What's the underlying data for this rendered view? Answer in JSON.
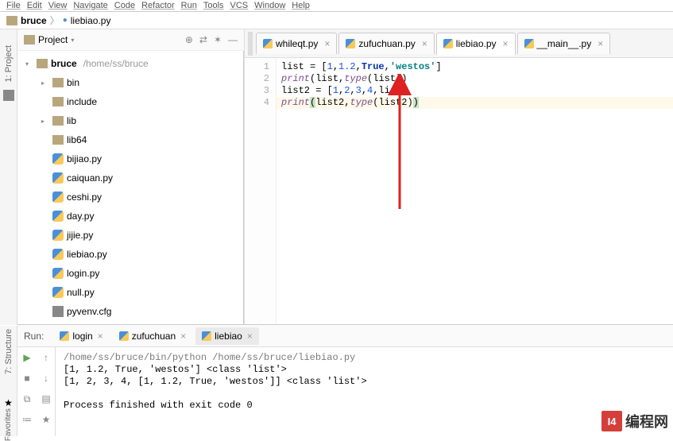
{
  "menubar": [
    "File",
    "Edit",
    "View",
    "Navigate",
    "Code",
    "Refactor",
    "Run",
    "Tools",
    "VCS",
    "Window",
    "Help"
  ],
  "breadcrumb": {
    "project": "bruce",
    "file": "liebiao.py",
    "sep": "〉"
  },
  "project_panel": {
    "title": "Project",
    "scope_icons": [
      "⊕",
      "⇄",
      "✶",
      "—"
    ],
    "root": {
      "name": "bruce",
      "path": "/home/ss/bruce"
    },
    "items": [
      {
        "type": "folder",
        "name": "bin",
        "depth": 1,
        "expandable": true
      },
      {
        "type": "folder",
        "name": "include",
        "depth": 1,
        "expandable": false
      },
      {
        "type": "folder",
        "name": "lib",
        "depth": 1,
        "expandable": true
      },
      {
        "type": "folder",
        "name": "lib64",
        "depth": 1,
        "expandable": false
      },
      {
        "type": "py",
        "name": "bijiao.py",
        "depth": 1
      },
      {
        "type": "py",
        "name": "caiquan.py",
        "depth": 1
      },
      {
        "type": "py",
        "name": "ceshi.py",
        "depth": 1
      },
      {
        "type": "py",
        "name": "day.py",
        "depth": 1
      },
      {
        "type": "py",
        "name": "jijie.py",
        "depth": 1
      },
      {
        "type": "py",
        "name": "liebiao.py",
        "depth": 1
      },
      {
        "type": "py",
        "name": "login.py",
        "depth": 1
      },
      {
        "type": "py",
        "name": "null.py",
        "depth": 1
      },
      {
        "type": "cfg",
        "name": "pyvenv.cfg",
        "depth": 1
      }
    ]
  },
  "tabs": [
    {
      "name": "whileqt.py",
      "active": false
    },
    {
      "name": "zufuchuan.py",
      "active": false
    },
    {
      "name": "liebiao.py",
      "active": true
    },
    {
      "name": "__main__.py",
      "active": false
    }
  ],
  "code": {
    "lines": [
      "1",
      "2",
      "3",
      "4"
    ],
    "line1": {
      "a": "list = [",
      "n1": "1",
      "c": ",",
      "n2": "1.2",
      "c2": ",",
      "b": "True",
      "c3": ",",
      "s": "'westos'",
      "end": "]"
    },
    "line2": {
      "a": "print",
      "b": "(list,",
      "c": "type",
      "d": "(list))"
    },
    "line3": {
      "a": "list2 = [",
      "n1": "1",
      "c": ",",
      "n2": "2",
      "c2": ",",
      "n3": "3",
      "c3": ",",
      "n4": "4",
      "c4": ",list]"
    },
    "line4": {
      "a": "print",
      "p1": "(",
      "b": "list2,",
      "c": "type",
      "d": "(list2)",
      "p2": ")"
    }
  },
  "run": {
    "label": "Run:",
    "tabs": [
      {
        "name": "login",
        "active": false
      },
      {
        "name": "zufuchuan",
        "active": false
      },
      {
        "name": "liebiao",
        "active": true
      }
    ],
    "toolbar": [
      "▶",
      "↑",
      "■",
      "↓",
      "⧉",
      "▤",
      "≔",
      "★"
    ],
    "cmd": "/home/ss/bruce/bin/python /home/ss/bruce/liebiao.py",
    "out1": "[1, 1.2, True, 'westos'] <class 'list'>",
    "out2": "[1, 2, 3, 4, [1, 1.2, True, 'westos']] <class 'list'>",
    "exit": "Process finished with exit code 0"
  },
  "sidebar": {
    "project": "1: Project",
    "structure": "7: Structure",
    "favorites": "Favorites"
  },
  "watermark": {
    "logo": "I4",
    "text": "编程网"
  }
}
